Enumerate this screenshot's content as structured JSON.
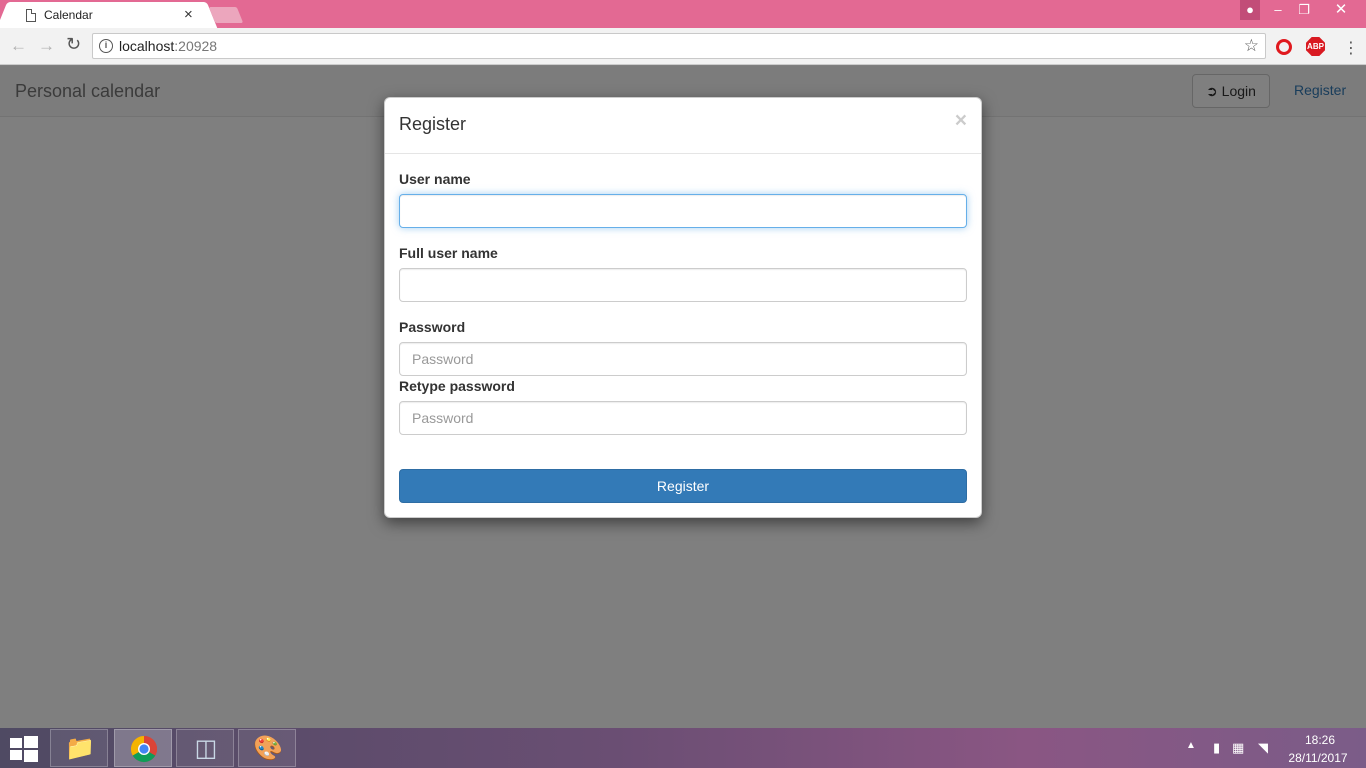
{
  "browser": {
    "tab_title": "Calendar",
    "tab_close": "×",
    "url_host": "localhost",
    "url_port": ":20928"
  },
  "navbar": {
    "brand": "Personal calendar",
    "login_label": "Login",
    "register_label": "Register"
  },
  "modal": {
    "title": "Register",
    "close": "×",
    "username_label": "User name",
    "username_value": "",
    "fullname_label": "Full user name",
    "fullname_value": "",
    "password_label": "Password",
    "password_placeholder": "Password",
    "retype_label": "Retype password",
    "retype_placeholder": "Password",
    "submit_label": "Register"
  },
  "taskbar": {
    "time": "18:26",
    "date": "28/11/2017"
  },
  "colors": {
    "titlebar": "#e36993",
    "primary_button": "#337ab7",
    "link": "#337ab7",
    "focus_border": "#66afe9"
  }
}
